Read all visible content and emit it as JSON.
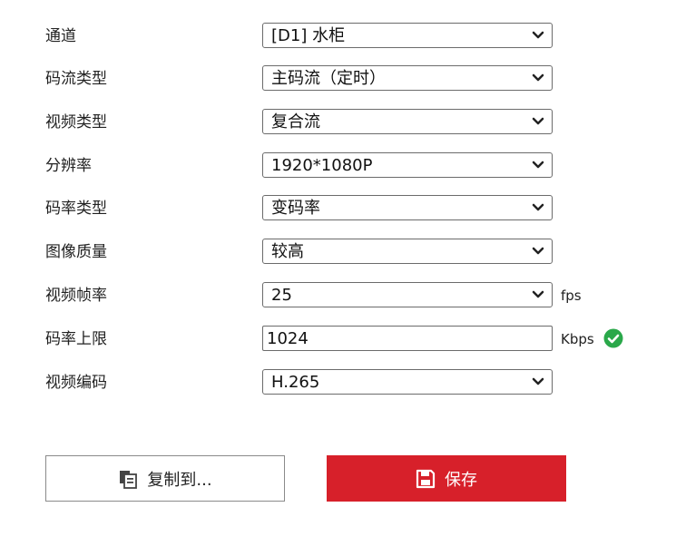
{
  "form": {
    "channel": {
      "label": "通道",
      "value": "[D1] 水柜"
    },
    "stream_type": {
      "label": "码流类型",
      "value": "主码流（定时）"
    },
    "video_type": {
      "label": "视频类型",
      "value": "复合流"
    },
    "resolution": {
      "label": "分辨率",
      "value": "1920*1080P"
    },
    "bitrate_type": {
      "label": "码率类型",
      "value": "变码率"
    },
    "image_quality": {
      "label": "图像质量",
      "value": "较高"
    },
    "frame_rate": {
      "label": "视频帧率",
      "value": "25",
      "unit": "fps"
    },
    "max_bitrate": {
      "label": "码率上限",
      "value": "1024",
      "unit": "Kbps"
    },
    "video_encoding": {
      "label": "视频编码",
      "value": "H.265"
    }
  },
  "buttons": {
    "copy_to": "复制到...",
    "save": "保存"
  },
  "colors": {
    "save_bg": "#d7202a",
    "valid_green": "#2aa84a"
  },
  "icons": {
    "select_chevron": "chevron-down-icon",
    "valid": "check-circle-icon",
    "copy": "copy-icon",
    "save": "floppy-disk-icon"
  }
}
